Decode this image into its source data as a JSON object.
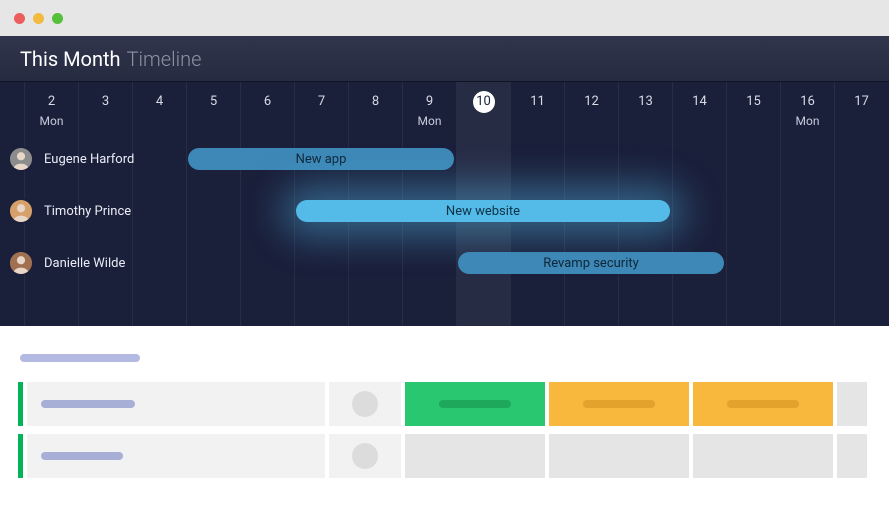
{
  "header": {
    "title": "This Month",
    "subtitle": "Timeline"
  },
  "days": [
    {
      "num": "2",
      "label": "Mon"
    },
    {
      "num": "3",
      "label": ""
    },
    {
      "num": "4",
      "label": ""
    },
    {
      "num": "5",
      "label": ""
    },
    {
      "num": "6",
      "label": ""
    },
    {
      "num": "7",
      "label": ""
    },
    {
      "num": "8",
      "label": ""
    },
    {
      "num": "9",
      "label": "Mon"
    },
    {
      "num": "10",
      "label": "",
      "current": true
    },
    {
      "num": "11",
      "label": ""
    },
    {
      "num": "12",
      "label": ""
    },
    {
      "num": "13",
      "label": ""
    },
    {
      "num": "14",
      "label": ""
    },
    {
      "num": "15",
      "label": ""
    },
    {
      "num": "16",
      "label": "Mon"
    },
    {
      "num": "17",
      "label": ""
    }
  ],
  "dayStartX": 24,
  "dayWidth": 54,
  "people": [
    {
      "name": "Eugene Harford",
      "avatarColor": "#8c8c8c"
    },
    {
      "name": "Timothy Prince",
      "avatarColor": "#d6a06b"
    },
    {
      "name": "Danielle Wilde",
      "avatarColor": "#a07050"
    }
  ],
  "tasks": [
    {
      "person": 0,
      "label": "New app",
      "startDay": 3,
      "endDay": 7,
      "style": "dark"
    },
    {
      "person": 1,
      "label": "New website",
      "startDay": 5,
      "endDay": 11,
      "style": "glow"
    },
    {
      "person": 2,
      "label": "Revamp security",
      "startDay": 8,
      "endDay": 12,
      "style": "dim"
    }
  ],
  "lowerGrid": {
    "groupPlaceholderWidth": 120,
    "rows": [
      {
        "titleWidth": 94,
        "cells": [
          "green",
          "orange",
          "orange",
          "grey-narrow"
        ]
      },
      {
        "titleWidth": 82,
        "cells": [
          "grey",
          "grey",
          "grey",
          "grey-narrow"
        ]
      }
    ]
  },
  "colors": {
    "taskDark": "#3d88b6",
    "taskLight": "#54bbe8",
    "green": "#29c770",
    "orange": "#f8b83e"
  }
}
